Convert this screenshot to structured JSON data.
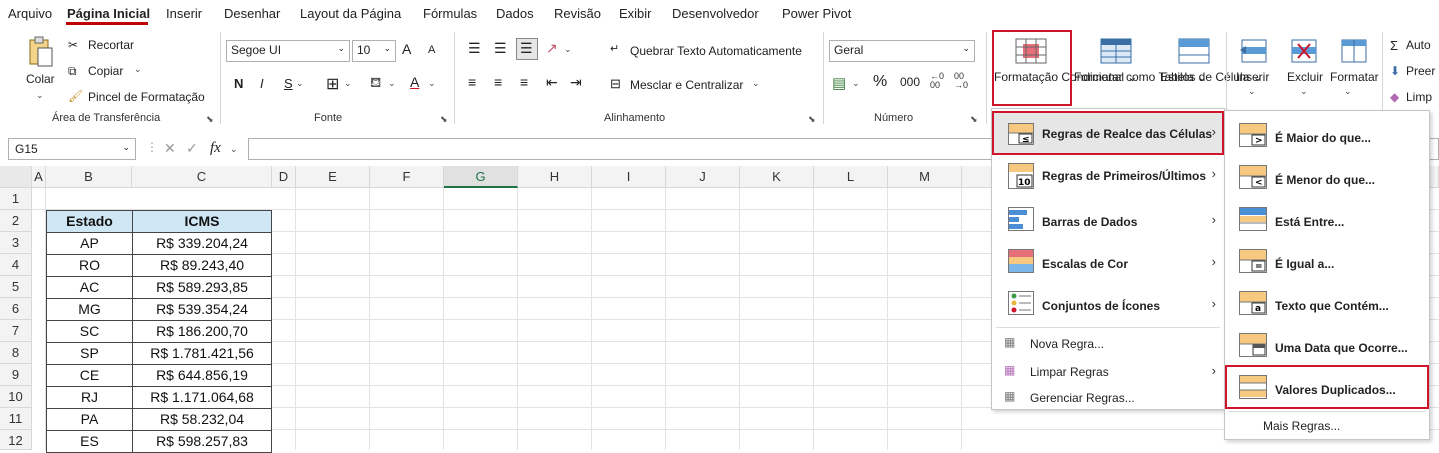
{
  "tabs": [
    "Arquivo",
    "Página Inicial",
    "Inserir",
    "Desenhar",
    "Layout da Página",
    "Fórmulas",
    "Dados",
    "Revisão",
    "Exibir",
    "Desenvolvedor",
    "Power Pivot"
  ],
  "ribbon": {
    "clipboard": {
      "paste": "Colar",
      "cut": "Recortar",
      "copy": "Copiar",
      "format_painter": "Pincel de Formatação",
      "group": "Área de Transferência"
    },
    "font": {
      "name": "Segoe UI",
      "size": "10",
      "bold": "N",
      "italic": "I",
      "underline": "S",
      "group": "Fonte",
      "grow": "A",
      "shrink": "A",
      "font_color": "A"
    },
    "alignment": {
      "wrap": "Quebrar Texto Automaticamente",
      "merge": "Mesclar e Centralizar",
      "group": "Alinhamento"
    },
    "number": {
      "format": "Geral",
      "percent": "%",
      "comma": "000",
      "group": "Número"
    },
    "styles": {
      "conditional": "Formatação Condicional",
      "format_table": "Formatar como Tabela",
      "cell_styles": "Estilos de Célula"
    },
    "cells": {
      "insert": "Inserir",
      "delete": "Excluir",
      "format": "Formatar"
    },
    "editing": {
      "autosum": "Auto",
      "fill": "Preer",
      "clear": "Limp"
    }
  },
  "formula_bar": {
    "name_box": "G15",
    "fx": "fx"
  },
  "columns": [
    "A",
    "B",
    "C",
    "D",
    "E",
    "F",
    "G",
    "H",
    "I",
    "J",
    "K",
    "L",
    "M"
  ],
  "rows": [
    "1",
    "2",
    "3",
    "4",
    "5",
    "6",
    "7",
    "8",
    "9",
    "10",
    "11",
    "12"
  ],
  "table": {
    "headers": [
      "Estado",
      "ICMS"
    ],
    "rows": [
      [
        "AP",
        "R$ 339.204,24"
      ],
      [
        "RO",
        "R$ 89.243,40"
      ],
      [
        "AC",
        "R$ 589.293,85"
      ],
      [
        "MG",
        "R$ 539.354,24"
      ],
      [
        "SC",
        "R$ 186.200,70"
      ],
      [
        "SP",
        "R$ 1.781.421,56"
      ],
      [
        "CE",
        "R$ 644.856,19"
      ],
      [
        "RJ",
        "R$ 1.171.064,68"
      ],
      [
        "PA",
        "R$ 58.232,04"
      ],
      [
        "ES",
        "R$ 598.257,83"
      ]
    ]
  },
  "cf_menu": {
    "items": [
      "Regras de Realce das Células",
      "Regras de Primeiros/Últimos",
      "Barras de Dados",
      "Escalas de Cor",
      "Conjuntos de Ícones"
    ],
    "bottom": [
      "Nova Regra...",
      "Limpar Regras",
      "Gerenciar Regras..."
    ]
  },
  "highlight_menu": {
    "items": [
      "É Maior do que...",
      "É Menor do que...",
      "Está Entre...",
      "É Igual a...",
      "Texto que Contém...",
      "Uma Data que Ocorre...",
      "Valores Duplicados..."
    ],
    "more": "Mais Regras..."
  },
  "colors": {
    "accent_red": "#d0142c",
    "header_fill": "#cfe7f5",
    "selected_col": "#217346"
  }
}
